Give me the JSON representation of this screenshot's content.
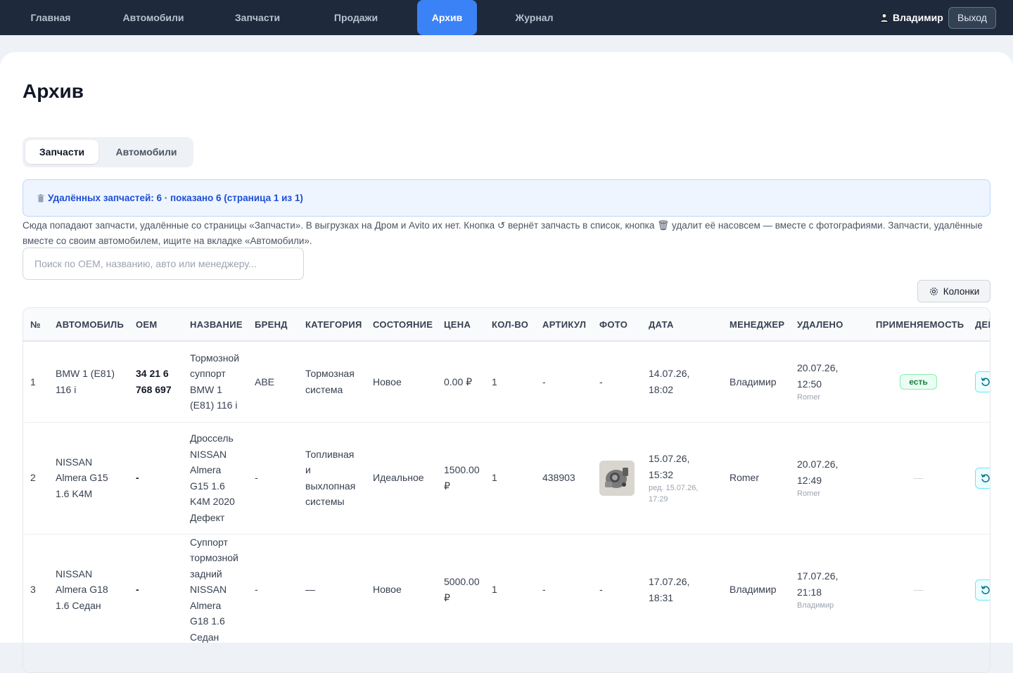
{
  "nav": {
    "items": [
      "Главная",
      "Автомобили",
      "Запчасти",
      "Продажи",
      "Архив",
      "Журнал"
    ],
    "active": "Архив",
    "user": "Владимир",
    "logout": "Выход"
  },
  "page": {
    "title": "Архив",
    "tabs": [
      "Запчасти",
      "Автомобили"
    ],
    "active_tab": "Запчасти",
    "info": "Удалённых запчастей: 6 · показано 6 (страница 1 из 1)",
    "description": "Сюда попадают запчасти, удалённые со страницы «Запчасти». В выгрузках на Дром и Avito их нет. Кнопка ↺ вернёт запчасть в список, кнопка 🗑 удалит её насовсем — вместе с фотографиями. Запчасти, удалённые вместе со своим автомобилем, ищите на вкладке «Автомобили».",
    "search_placeholder": "Поиск по OEM, названию, авто или менеджеру...",
    "search_value": "",
    "columns_button": "Колонки"
  },
  "table": {
    "headers": [
      "№",
      "АВТОМОБИЛЬ",
      "OEM",
      "НАЗВАНИЕ",
      "БРЕНД",
      "КАТЕГОРИЯ",
      "СОСТОЯНИЕ",
      "ЦЕНА",
      "КОЛ-ВО",
      "АРТИКУЛ",
      "ФОТО",
      "ДАТА",
      "МЕНЕДЖЕР",
      "УДАЛЕНО",
      "ПРИМЕНЯЕМОСТЬ",
      "ДЕЙСТВИЯ"
    ],
    "rows": [
      {
        "num": "1",
        "car": "BMW 1 (E81) 116 i",
        "oem": "34 21 6 768 697",
        "name": "Тормозной суппорт BMW 1 (E81) 116 i",
        "brand": "ABE",
        "category": "Тормозная система",
        "condition": "Новое",
        "price": "0.00 ₽",
        "qty": "1",
        "article": "-",
        "photo": "-",
        "date": "14.07.26, 18:02",
        "date_edit": "",
        "manager": "Владимир",
        "deleted": "20.07.26, 12:50",
        "deleted_by": "Romer",
        "applicability": "есть"
      },
      {
        "num": "2",
        "car": "NISSAN Almera G15 1.6 K4M",
        "oem": "-",
        "name": "Дроссель NISSAN Almera G15 1.6 K4M 2020 Дефект",
        "brand": "-",
        "category": "Топливная и выхлопная системы",
        "condition": "Идеальное",
        "price": "1500.00 ₽",
        "qty": "1",
        "article": "438903",
        "photo": "",
        "date": "15.07.26, 15:32",
        "date_edit": "ред. 15.07.26, 17:29",
        "manager": "Romer",
        "deleted": "20.07.26, 12:49",
        "deleted_by": "Romer",
        "applicability": "—"
      },
      {
        "num": "3",
        "car": "NISSAN Almera G18 1.6 Седан",
        "oem": "-",
        "name": "Суппорт тормозной задний NISSAN Almera G18 1.6 Седан",
        "brand": "-",
        "category": "—",
        "condition": "Новое",
        "price": "5000.00 ₽",
        "qty": "1",
        "article": "-",
        "photo": "-",
        "date": "17.07.26, 18:31",
        "date_edit": "",
        "manager": "Владимир",
        "deleted": "17.07.26, 21:18",
        "deleted_by": "Владимир",
        "applicability": "—"
      }
    ]
  }
}
